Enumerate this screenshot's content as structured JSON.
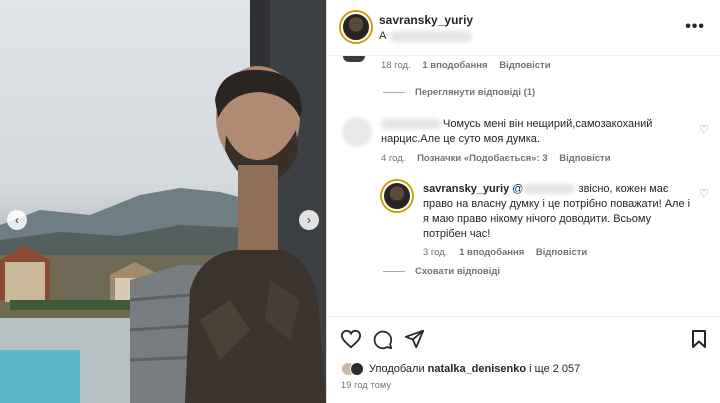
{
  "post": {
    "author": "savransky_yuriy",
    "location_prefix": "А",
    "more_icon": "more-horizontal-icon"
  },
  "comments": [
    {
      "id": "prev",
      "meta": {
        "time": "18 год.",
        "likes": "1 вподобання",
        "reply": "Відповісти"
      },
      "view_replies": "Переглянути відповіді (1)"
    },
    {
      "id": "c1",
      "text": "Чомусь мені він нещирий,самозакоханий нарцис.Але це суто моя думка.",
      "meta": {
        "time": "4 год.",
        "likes": "Позначки «Подобається»: 3",
        "reply": "Відповісти"
      }
    },
    {
      "id": "r1",
      "author": "savransky_yuriy",
      "mention": "@",
      "text": "звісно, кожен має право на власну думку і це потрібно поважати! Але і я маю право нікому нічого доводити. Всьому потрібен час!",
      "meta": {
        "time": "3 год.",
        "likes": "1 вподобання",
        "reply": "Відповісти"
      },
      "hide_replies": "Сховати відповіді"
    }
  ],
  "actions": {
    "liked_by_prefix": "Уподобали",
    "liked_by_user": "natalka_denisenko",
    "liked_by_suffix": "і ще 2 057",
    "time_ago": "19 год тому"
  }
}
